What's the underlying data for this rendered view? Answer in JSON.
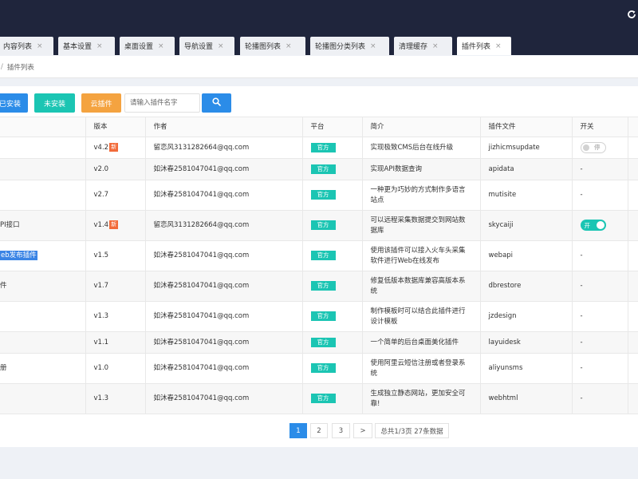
{
  "tabs": [
    {
      "label": "内容列表"
    },
    {
      "label": "基本设置"
    },
    {
      "label": "桌面设置"
    },
    {
      "label": "导航设置"
    },
    {
      "label": "轮播图列表"
    },
    {
      "label": "轮播图分类列表"
    },
    {
      "label": "清理缓存"
    },
    {
      "label": "插件列表"
    }
  ],
  "tab_close": "×",
  "breadcrumb": {
    "sep": "/",
    "current": "插件列表"
  },
  "toolbar": {
    "installed_label": "已安装",
    "uninstalled_label": "未安装",
    "cloud_label": "云插件",
    "search_placeholder": "请输入插件名字"
  },
  "table": {
    "headers": {
      "version": "版本",
      "author": "作者",
      "platform": "平台",
      "intro": "简介",
      "file": "插件文件",
      "switch": "开关"
    },
    "rows": [
      {
        "name": "",
        "version": "v4.2",
        "is_new": "新",
        "author": "留恋风3131282664@qq.com",
        "platform": "官方",
        "intro": "实现极致CMS后台在线升级",
        "file": "jizhicmsupdate",
        "switch_label": "停",
        "switch_state": "off"
      },
      {
        "name": "",
        "version": "v2.0",
        "author": "如沐春2581047041@qq.com",
        "platform": "官方",
        "intro": "实现API数据查询",
        "file": "apidata",
        "switch_text": "-"
      },
      {
        "name": "",
        "version": "v2.7",
        "author": "如沐春2581047041@qq.com",
        "platform": "官方",
        "intro": "一种更为巧妙的方式制作多语言站点",
        "file": "mutisite",
        "switch_text": "-"
      },
      {
        "name": "PI接口",
        "version": "v1.4",
        "is_new": "新",
        "author": "留恋风3131282664@qq.com",
        "platform": "官方",
        "intro": "可以远程采集数据提交到网站数据库",
        "file": "skycaiji",
        "switch_label": "开",
        "switch_state": "on"
      },
      {
        "name": "eb发布插件",
        "highlight": true,
        "version": "v1.5",
        "author": "如沐春2581047041@qq.com",
        "platform": "官方",
        "intro": "使用该插件可以接入火车头采集软件进行Web在线发布",
        "file": "webapi",
        "switch_text": "-"
      },
      {
        "name": "件",
        "version": "v1.7",
        "author": "如沐春2581047041@qq.com",
        "platform": "官方",
        "intro": "修复低版本数据库兼容高版本系统",
        "file": "dbrestore",
        "switch_text": "-"
      },
      {
        "name": "",
        "version": "v1.3",
        "author": "如沐春2581047041@qq.com",
        "platform": "官方",
        "intro": "制作模板时可以结合此插件进行设计模板",
        "file": "jzdesign",
        "switch_text": "-"
      },
      {
        "name": "",
        "version": "v1.1",
        "author": "如沐春2581047041@qq.com",
        "platform": "官方",
        "intro": "一个简单的后台桌面美化插件",
        "file": "layuidesk",
        "switch_text": "-"
      },
      {
        "name": "册",
        "version": "v1.0",
        "author": "如沐春2581047041@qq.com",
        "platform": "官方",
        "intro": "使用阿里云短信注册或者登录系统",
        "file": "aliyunsms",
        "switch_text": "-"
      },
      {
        "name": "",
        "version": "v1.3",
        "author": "如沐春2581047041@qq.com",
        "platform": "官方",
        "intro": "生成独立静态网站，更加安全可靠!",
        "file": "webhtml",
        "switch_text": "-"
      }
    ]
  },
  "pagination": {
    "pages": [
      "1",
      "2",
      "3"
    ],
    "active_page": "1",
    "next": ">",
    "summary": "总共1/3页 27条数据"
  }
}
